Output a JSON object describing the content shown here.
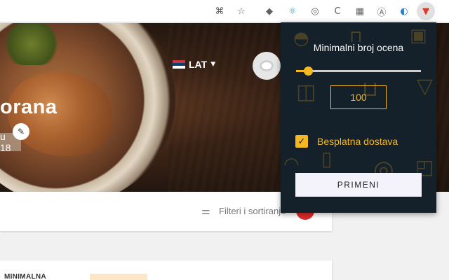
{
  "browser_toolbar": {
    "icons": [
      "translate-icon",
      "star-icon",
      "ublock-shield-icon",
      "react-devtools-icon",
      "extension-swirl-icon",
      "extension-c-icon",
      "extension-grid-icon",
      "extension-a-icon",
      "extension-bird-icon",
      "fries-extension-icon"
    ]
  },
  "hero": {
    "restaurant_name_partial": "orana",
    "hours_partial": "u 18",
    "language": "LAT"
  },
  "filters": {
    "label": "Filteri i sortiranje"
  },
  "info_card": {
    "min_label": "MINIMALNA"
  },
  "popup": {
    "title": "Minimalni broj ocena",
    "slider_value": 100,
    "slider_fraction": 0.1,
    "value_text": "100",
    "free_delivery_label": "Besplatna dostava",
    "free_delivery_checked": true,
    "apply_label": "PRIMENI",
    "accent_color": "#f5b820",
    "background_color": "#14202a"
  }
}
